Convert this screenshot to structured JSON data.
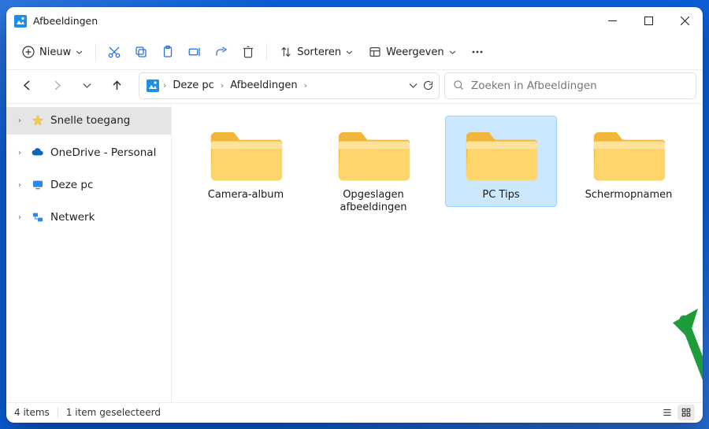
{
  "titlebar": {
    "title": "Afbeeldingen"
  },
  "toolbar": {
    "new_label": "Nieuw",
    "sort_label": "Sorteren",
    "view_label": "Weergeven"
  },
  "breadcrumb": {
    "root": "Deze pc",
    "folder": "Afbeeldingen"
  },
  "search": {
    "placeholder": "Zoeken in Afbeeldingen"
  },
  "sidebar": {
    "items": [
      {
        "label": "Snelle toegang"
      },
      {
        "label": "OneDrive - Personal"
      },
      {
        "label": "Deze pc"
      },
      {
        "label": "Netwerk"
      }
    ]
  },
  "folders": [
    {
      "label": "Camera-album",
      "selected": false
    },
    {
      "label": "Opgeslagen afbeeldingen",
      "selected": false
    },
    {
      "label": "PC Tips",
      "selected": true
    },
    {
      "label": "Schermopnamen",
      "selected": false
    }
  ],
  "status": {
    "count": "4 items",
    "selected": "1 item geselecteerd"
  }
}
